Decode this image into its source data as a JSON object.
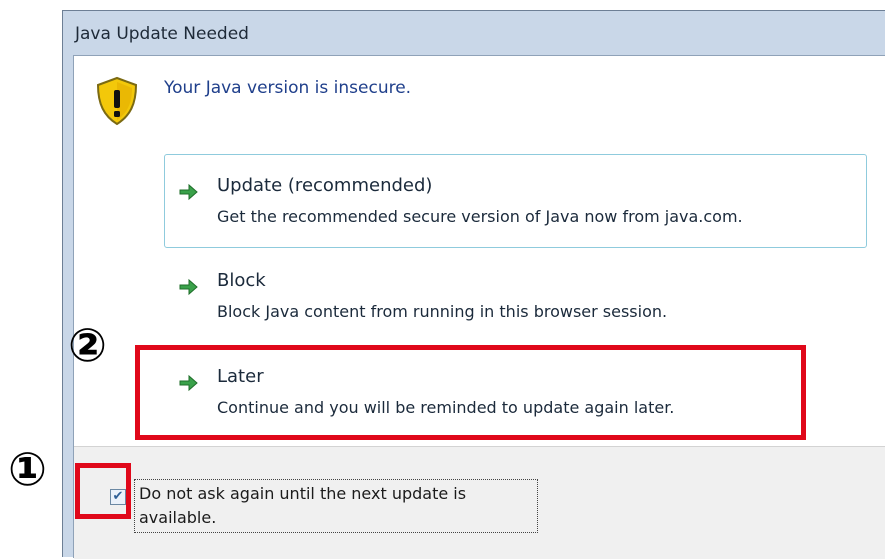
{
  "window": {
    "title": "Java Update Needed"
  },
  "message": "Your Java version is insecure.",
  "options": [
    {
      "title": "Update (recommended)",
      "desc": "Get the recommended secure version of Java now from java.com."
    },
    {
      "title": "Block",
      "desc": "Block Java content from running in this browser session."
    },
    {
      "title": "Later",
      "desc": "Continue and you will be reminded to update again later."
    }
  ],
  "footer": {
    "checkbox_label": "Do not ask again until the next update is available.",
    "checkbox_checked": true
  },
  "annotations": {
    "marker_1": "①",
    "marker_2": "②"
  },
  "colors": {
    "highlight": "#e0081a",
    "arrow": "#3aa14a",
    "message": "#1f3f8b"
  }
}
